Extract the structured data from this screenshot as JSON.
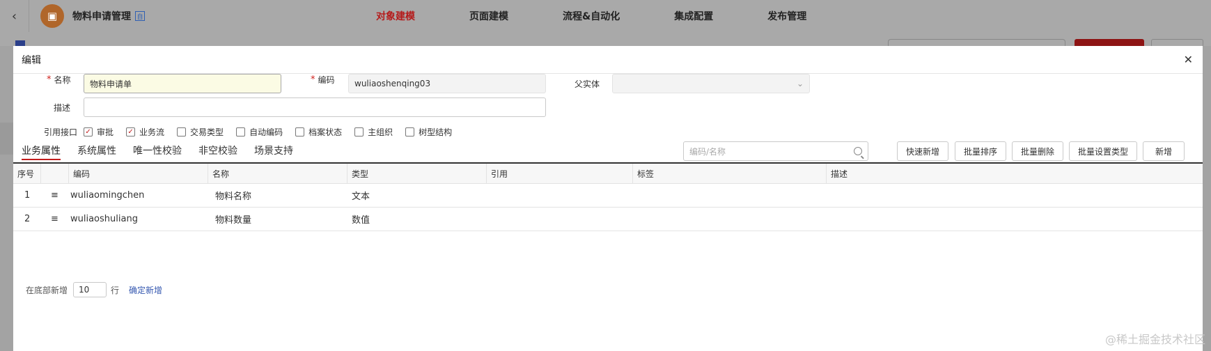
{
  "header": {
    "app_title": "物料申请管理",
    "badge": "自",
    "nav": [
      "对象建模",
      "页面建模",
      "流程&自动化",
      "集成配置",
      "发布管理"
    ]
  },
  "modal": {
    "title": "编辑",
    "fields": {
      "name_label": "名称",
      "name_value": "物料申请单",
      "code_label": "编码",
      "code_value": "wuliaoshenqing03",
      "parent_label": "父实体",
      "desc_label": "描述",
      "desc_value": ""
    },
    "interfaces": {
      "label": "引用接口",
      "items": [
        {
          "label": "审批",
          "checked": true
        },
        {
          "label": "业务流",
          "checked": true
        },
        {
          "label": "交易类型",
          "checked": false
        },
        {
          "label": "自动编码",
          "checked": false
        },
        {
          "label": "档案状态",
          "checked": false
        },
        {
          "label": "主组织",
          "checked": false
        },
        {
          "label": "树型结构",
          "checked": false
        }
      ]
    },
    "tabs": [
      "业务属性",
      "系统属性",
      "唯一性校验",
      "非空校验",
      "场景支持"
    ],
    "search_placeholder": "编码/名称",
    "buttons": [
      "快速新增",
      "批量排序",
      "批量删除",
      "批量设置类型",
      "新增"
    ],
    "table": {
      "columns": [
        "序号",
        "",
        "编码",
        "名称",
        "类型",
        "引用",
        "标签",
        "描述"
      ],
      "rows": [
        {
          "index": "1",
          "code": "wuliaomingchen",
          "name": "物料名称",
          "type": "文本"
        },
        {
          "index": "2",
          "code": "wuliaoshuliang",
          "name": "物料数量",
          "type": "数值"
        }
      ]
    },
    "footer": {
      "prefix": "在底部新增",
      "count": "10",
      "unit": "行",
      "confirm": "确定新增"
    }
  },
  "watermark": "@稀土掘金技术社区",
  "colors": {
    "accent": "#c21c1c",
    "link": "#3558b0"
  }
}
